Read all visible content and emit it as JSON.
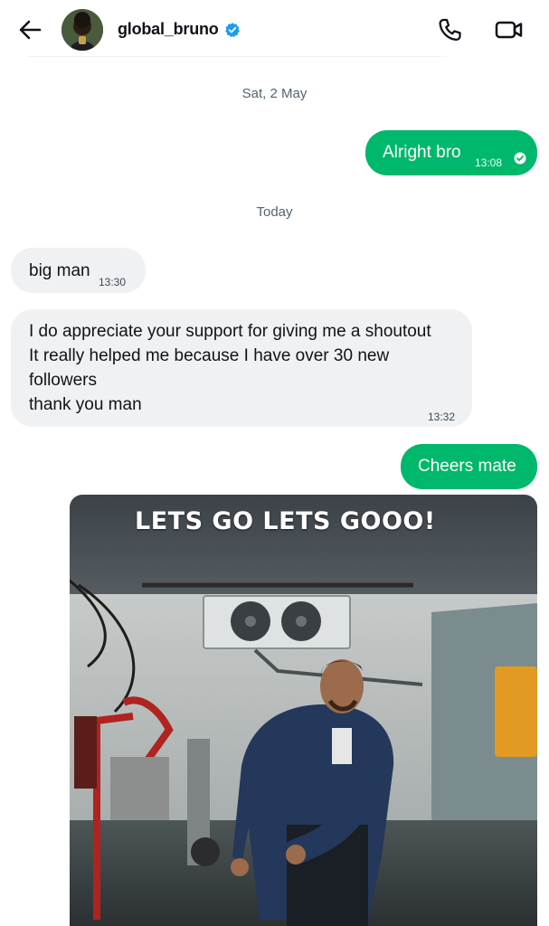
{
  "header": {
    "username": "global_bruno",
    "verified": true,
    "icons": {
      "back": "arrow-left-icon",
      "verified": "verified-badge-icon",
      "call": "phone-icon",
      "video": "video-camera-icon"
    }
  },
  "colors": {
    "outgoing_bubble": "#00b86b",
    "incoming_bubble": "#eff1f3",
    "verified_blue": "#1d9bf0",
    "date_text": "#536471"
  },
  "conversation": {
    "date_separators": [
      "Sat, 2 May",
      "Today"
    ],
    "messages": [
      {
        "direction": "outgoing",
        "text": "Alright bro",
        "time": "13:08",
        "read": true
      },
      {
        "direction": "incoming",
        "text": "big man",
        "time": "13:30"
      },
      {
        "direction": "incoming",
        "lines": [
          "I do appreciate your support for giving me a shoutout",
          "It really helped me because I have over 30 new",
          "followers",
          "thank you man"
        ],
        "time": "13:32"
      },
      {
        "direction": "outgoing",
        "text": "Cheers mate"
      },
      {
        "direction": "outgoing",
        "type": "gif",
        "caption": "LETS GO LETS GOOO!"
      }
    ]
  }
}
